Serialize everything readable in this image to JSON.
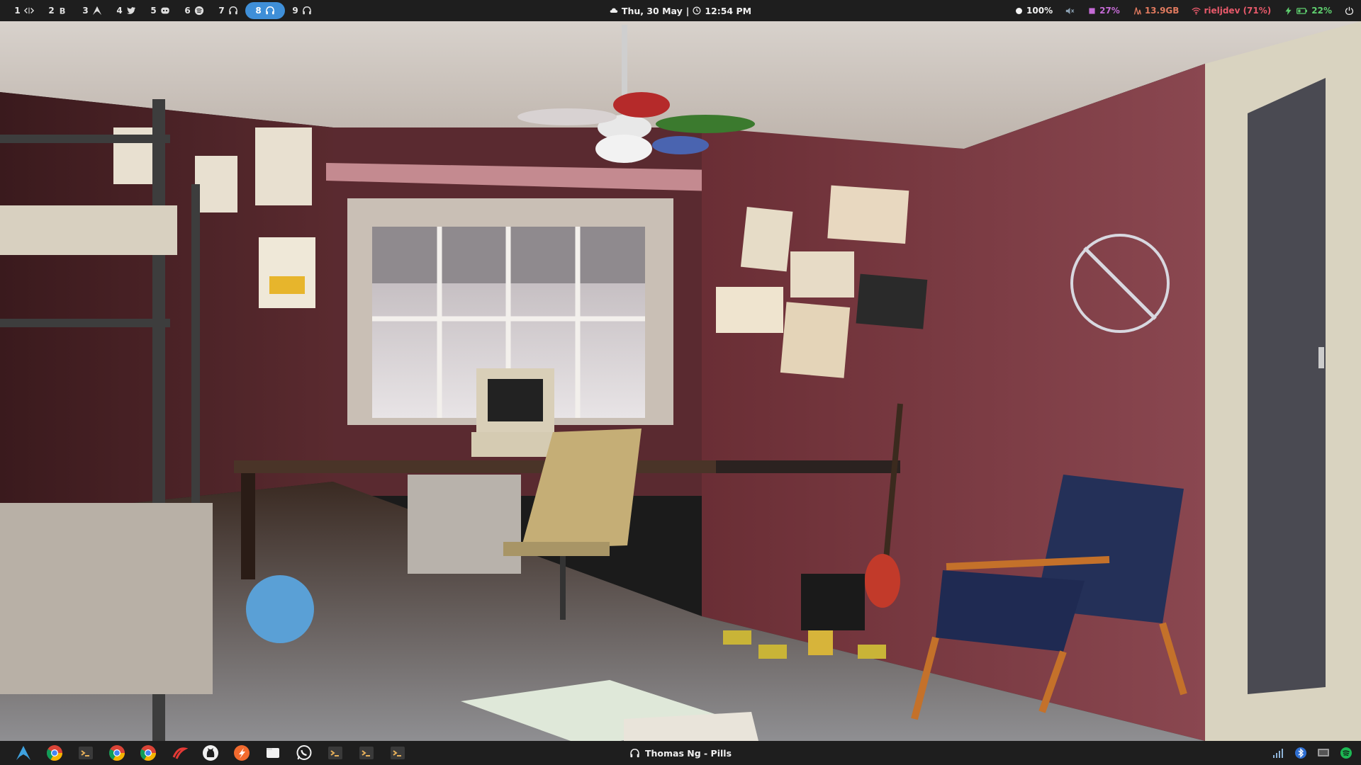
{
  "topbar": {
    "workspaces": [
      {
        "num": "1",
        "icon": "code-icon"
      },
      {
        "num": "2",
        "icon": "bitcoin-icon"
      },
      {
        "num": "3",
        "icon": "arch-icon"
      },
      {
        "num": "4",
        "icon": "twitter-icon"
      },
      {
        "num": "5",
        "icon": "discord-icon"
      },
      {
        "num": "6",
        "icon": "spotify-icon"
      },
      {
        "num": "7",
        "icon": "headphones-icon"
      },
      {
        "num": "8",
        "icon": "headphones-icon",
        "active": true
      },
      {
        "num": "9",
        "icon": "headphones-icon"
      }
    ],
    "clock": {
      "date": "Thu, 30 May",
      "separator": "|",
      "time": "12:54 PM"
    },
    "status": {
      "brightness": "100%",
      "volume_icon": "mute-icon",
      "cpu": "27%",
      "memory": "13.9GB",
      "wifi": "rieljdev (71%)",
      "battery": "22%"
    }
  },
  "bottombar": {
    "dock": [
      "arch-launcher-icon",
      "chrome-icon",
      "terminal-icon",
      "chrome-icon",
      "chrome-icon",
      "rstudio-icon",
      "github-icon",
      "brave-icon",
      "files-icon",
      "whatsapp-icon",
      "terminal-icon",
      "terminal-icon",
      "terminal-icon"
    ],
    "nowplaying": "Thomas Ng - Pills",
    "tray": [
      "network-bars-icon",
      "bluetooth-icon",
      "display-icon",
      "spotify-tray-icon"
    ]
  },
  "colors": {
    "bar_bg": "#1e1e1e",
    "active_ws": "#3f8fd8",
    "cpu": "#c56bd6",
    "memory": "#e07a5f",
    "wifi": "#e85a6b",
    "battery": "#5fcf6f",
    "volume": "#8a9fb0"
  }
}
